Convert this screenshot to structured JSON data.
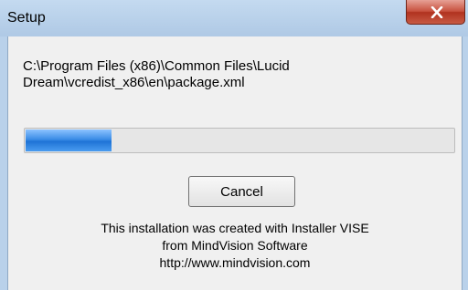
{
  "window": {
    "title": "Setup",
    "close_icon": "close-x-icon"
  },
  "status": {
    "path_line1": "C:\\Program Files (x86)\\Common Files\\Lucid",
    "path_line2": "Dream\\vcredist_x86\\en\\package.xml"
  },
  "progress": {
    "fraction": 0.2
  },
  "buttons": {
    "cancel_label": "Cancel"
  },
  "footer": {
    "line1": "This installation was created with Installer VISE",
    "line2": "from MindVision Software",
    "line3": "http://www.mindvision.com"
  },
  "colors": {
    "titlebar": "#b9d1ea",
    "close_button": "#c7503d",
    "progress_fill": "#3b8de6",
    "dialog_background": "#f0f0f0"
  }
}
